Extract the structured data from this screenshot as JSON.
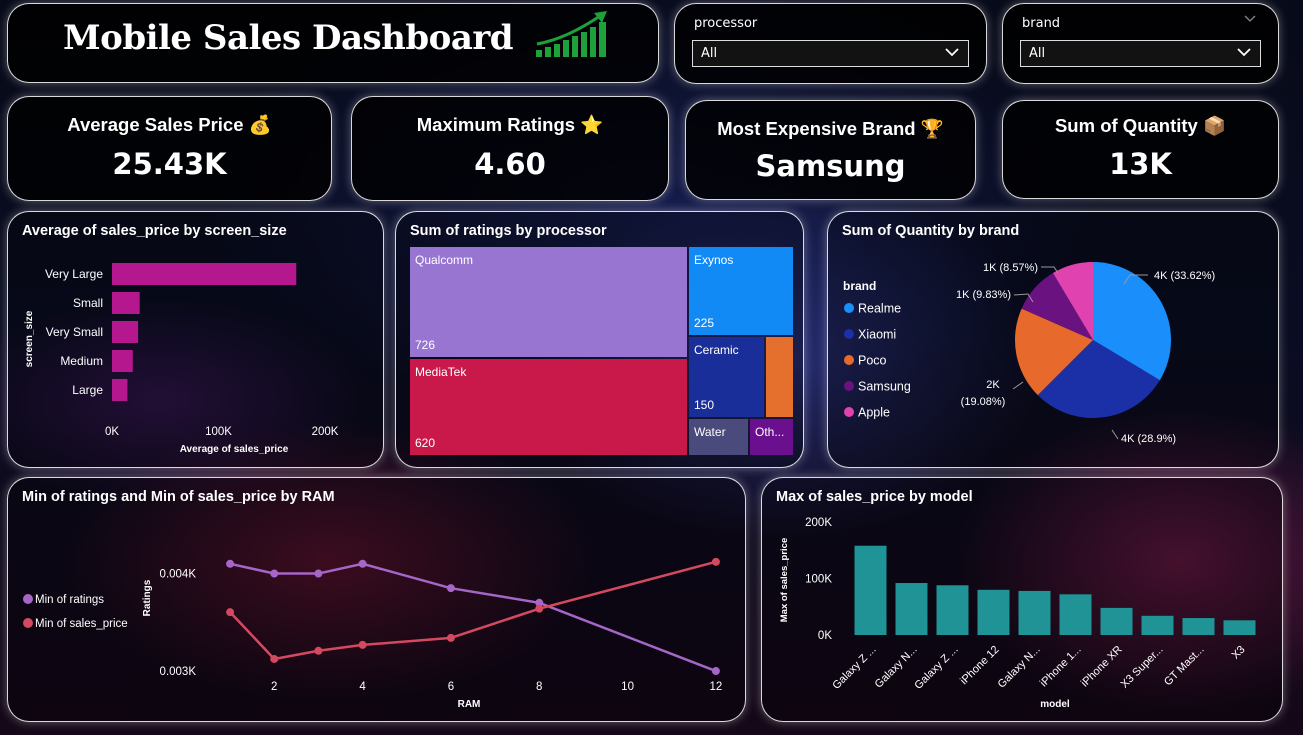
{
  "header": {
    "title": "Mobile Sales Dashboard",
    "growth_icon": "growth-bars-icon",
    "growth_icon_color": "#1ea03a"
  },
  "filters": {
    "processor": {
      "label": "processor",
      "value": "All"
    },
    "brand": {
      "label": "brand",
      "value": "All"
    }
  },
  "kpis": [
    {
      "label": "Average Sales Price",
      "icon": "💰",
      "value": "25.43K"
    },
    {
      "label": "Maximum Ratings",
      "icon": "⭐",
      "value": "4.60"
    },
    {
      "label": "Most Expensive Brand",
      "icon": "🏆",
      "value": "Samsung"
    },
    {
      "label": "Sum of Quantity",
      "icon": "📦",
      "value": "13K"
    }
  ],
  "chart_data": [
    {
      "id": "screen-size-bar",
      "type": "bar",
      "orientation": "horizontal",
      "title": "Average of sales_price by screen_size",
      "xlabel": "Average of sales_price",
      "ylabel": "screen_size",
      "categories": [
        "Very Large",
        "Small",
        "Very Small",
        "Medium",
        "Large"
      ],
      "values": [
        173000,
        26000,
        24500,
        19500,
        14500
      ],
      "xlim": [
        0,
        230000
      ],
      "x_ticks": [
        "0K",
        "100K",
        "200K"
      ],
      "x_tick_values": [
        0,
        100000,
        200000
      ],
      "color": "#b5178f"
    },
    {
      "id": "processor-treemap",
      "type": "treemap",
      "title": "Sum of ratings by processor",
      "items": [
        {
          "name": "Qualcomm",
          "value": 726,
          "label": "726",
          "color": "#9775d0"
        },
        {
          "name": "MediaTek",
          "value": 620,
          "label": "620",
          "color": "#c8194a"
        },
        {
          "name": "Exynos",
          "value": 225,
          "label": "225",
          "color": "#128af6"
        },
        {
          "name": "Ceramic",
          "value": 150,
          "label": "150",
          "color": "#1a2e99"
        },
        {
          "name": "",
          "value": 46,
          "label": "",
          "color": "#e56f2c"
        },
        {
          "name": "Water",
          "value": 46,
          "label": "",
          "color": "#4a4a7c"
        },
        {
          "name": "Oth...",
          "value": 35,
          "label": "",
          "color": "#6a0f8e"
        }
      ]
    },
    {
      "id": "brand-pie",
      "type": "pie",
      "title": "Sum of Quantity by brand",
      "legend_title": "brand",
      "legend_position": "left",
      "slices": [
        {
          "name": "Realme",
          "value": 33.62,
          "label": "4K (33.62%)",
          "color": "#1a8ffc"
        },
        {
          "name": "Xiaomi",
          "value": 28.9,
          "label": "4K (28.9%)",
          "color": "#1b2fa6"
        },
        {
          "name": "Poco",
          "value": 19.08,
          "label_line1": "2K",
          "label_line2": "(19.08%)",
          "color": "#e8692c"
        },
        {
          "name": "Samsung",
          "value": 9.83,
          "label": "1K (9.83%)",
          "color": "#6a1380"
        },
        {
          "name": "Apple",
          "value": 8.57,
          "label": "1K (8.57%)",
          "color": "#e043b0"
        }
      ]
    },
    {
      "id": "ram-line",
      "type": "line",
      "title": "Min of ratings and Min of sales_price by RAM",
      "xlabel": "RAM",
      "ylabel": "Ratings",
      "x_ticks": [
        2,
        4,
        6,
        8,
        10,
        12
      ],
      "xlim": [
        0.5,
        12.5
      ],
      "y_ticks": [
        "0.004K",
        "0.003K"
      ],
      "y_tick_values": [
        4.0,
        3.0
      ],
      "ylim": [
        2.98,
        4.18
      ],
      "legend_position": "left",
      "series": [
        {
          "name": "Min of ratings",
          "color": "#a566c8",
          "points": [
            [
              1,
              4.1
            ],
            [
              2,
              4.0
            ],
            [
              3,
              4.0
            ],
            [
              4,
              4.1
            ],
            [
              6,
              3.85
            ],
            [
              8,
              3.7
            ],
            [
              12,
              3.0
            ]
          ]
        },
        {
          "name": "Min of sales_price",
          "color": "#d44960",
          "y_fraction": [
            0.52,
            0.12,
            0.19,
            0.24,
            0.3,
            0.55,
            0.95
          ],
          "x": [
            1,
            2,
            3,
            4,
            6,
            8,
            12
          ]
        }
      ]
    },
    {
      "id": "model-bar",
      "type": "bar",
      "title": "Max of sales_price by model",
      "xlabel": "model",
      "ylabel": "Max of sales_price",
      "categories": [
        "Galaxy Z ...",
        "Galaxy N...",
        "Galaxy Z ...",
        "iPhone 12",
        "Galaxy N...",
        "iPhone 1...",
        "iPhone XR",
        "X3 Super...",
        "GT Mast...",
        "X3"
      ],
      "values": [
        158000,
        92000,
        88000,
        80000,
        78000,
        72000,
        48000,
        34000,
        30000,
        26000
      ],
      "ylim": [
        0,
        200000
      ],
      "y_ticks": [
        "0K",
        "100K",
        "200K"
      ],
      "y_tick_values": [
        0,
        100000,
        200000
      ],
      "color": "#1f9396"
    }
  ]
}
